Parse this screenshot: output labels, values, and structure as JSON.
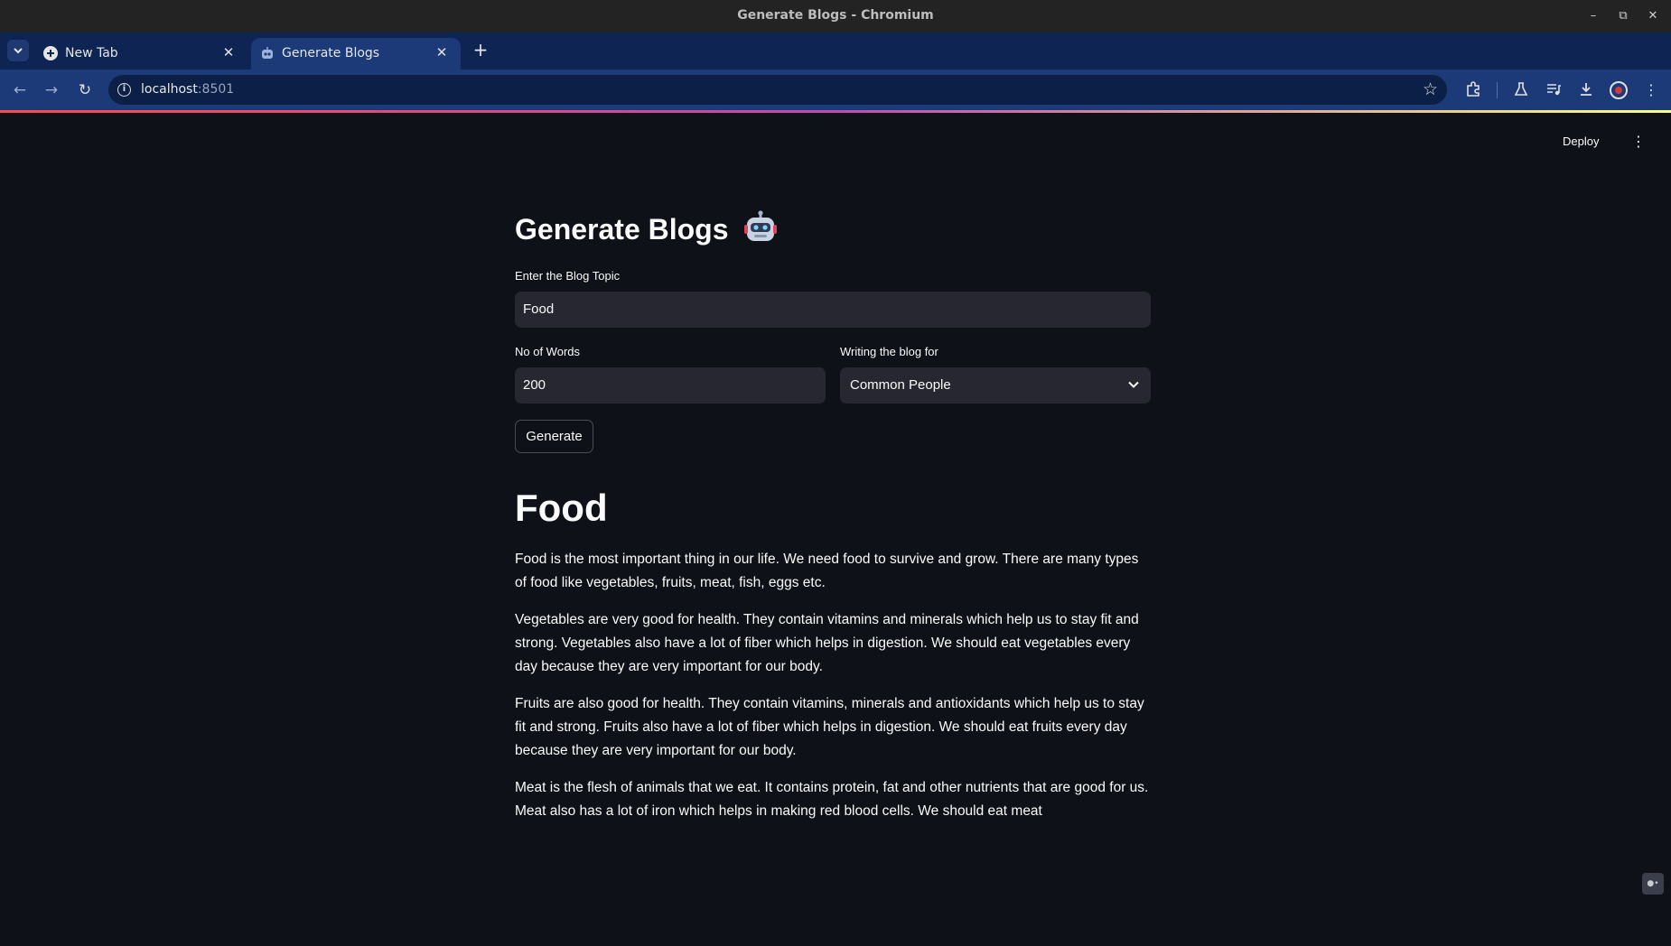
{
  "window": {
    "title": "Generate Blogs - Chromium"
  },
  "tabs": [
    {
      "label": "New Tab",
      "active": false
    },
    {
      "label": "Generate Blogs",
      "active": true
    }
  ],
  "address_bar": {
    "host": "localhost",
    "port": ":8501"
  },
  "app": {
    "deploy_label": "Deploy",
    "heading": "Generate Blogs",
    "topic": {
      "label": "Enter the Blog Topic",
      "value": "Food"
    },
    "words": {
      "label": "No of Words",
      "value": "200"
    },
    "audience": {
      "label": "Writing the blog for",
      "value": "Common People"
    },
    "generate_label": "Generate",
    "blog": {
      "title": "Food",
      "paragraphs": [
        "Food is the most important thing in our life. We need food to survive and grow. There are many types of food like vegetables, fruits, meat, fish, eggs etc.",
        "Vegetables are very good for health. They contain vitamins and minerals which help us to stay fit and strong. Vegetables also have a lot of fiber which helps in digestion. We should eat vegetables every day because they are very important for our body.",
        "Fruits are also good for health. They contain vitamins, minerals and antioxidants which help us to stay fit and strong. Fruits also have a lot of fiber which helps in digestion. We should eat fruits every day because they are very important for our body.",
        "Meat is the flesh of animals that we eat. It contains protein, fat and other nutrients that are good for us. Meat also has a lot of iron which helps in making red blood cells. We should eat meat"
      ]
    }
  },
  "colors": {
    "background": "#0e1117",
    "input_bg": "#262730",
    "tab_strip": "#0e2553",
    "toolbar": "#1c3a78"
  },
  "icons": [
    "tab-search-icon",
    "new-tab-icon",
    "close-icon",
    "back-icon",
    "forward-icon",
    "reload-icon",
    "site-info-icon",
    "bookmark-star-icon",
    "extensions-icon",
    "labs-icon",
    "media-icon",
    "download-icon",
    "profile-icon",
    "menu-icon",
    "robot-icon",
    "chevron-down-icon"
  ]
}
